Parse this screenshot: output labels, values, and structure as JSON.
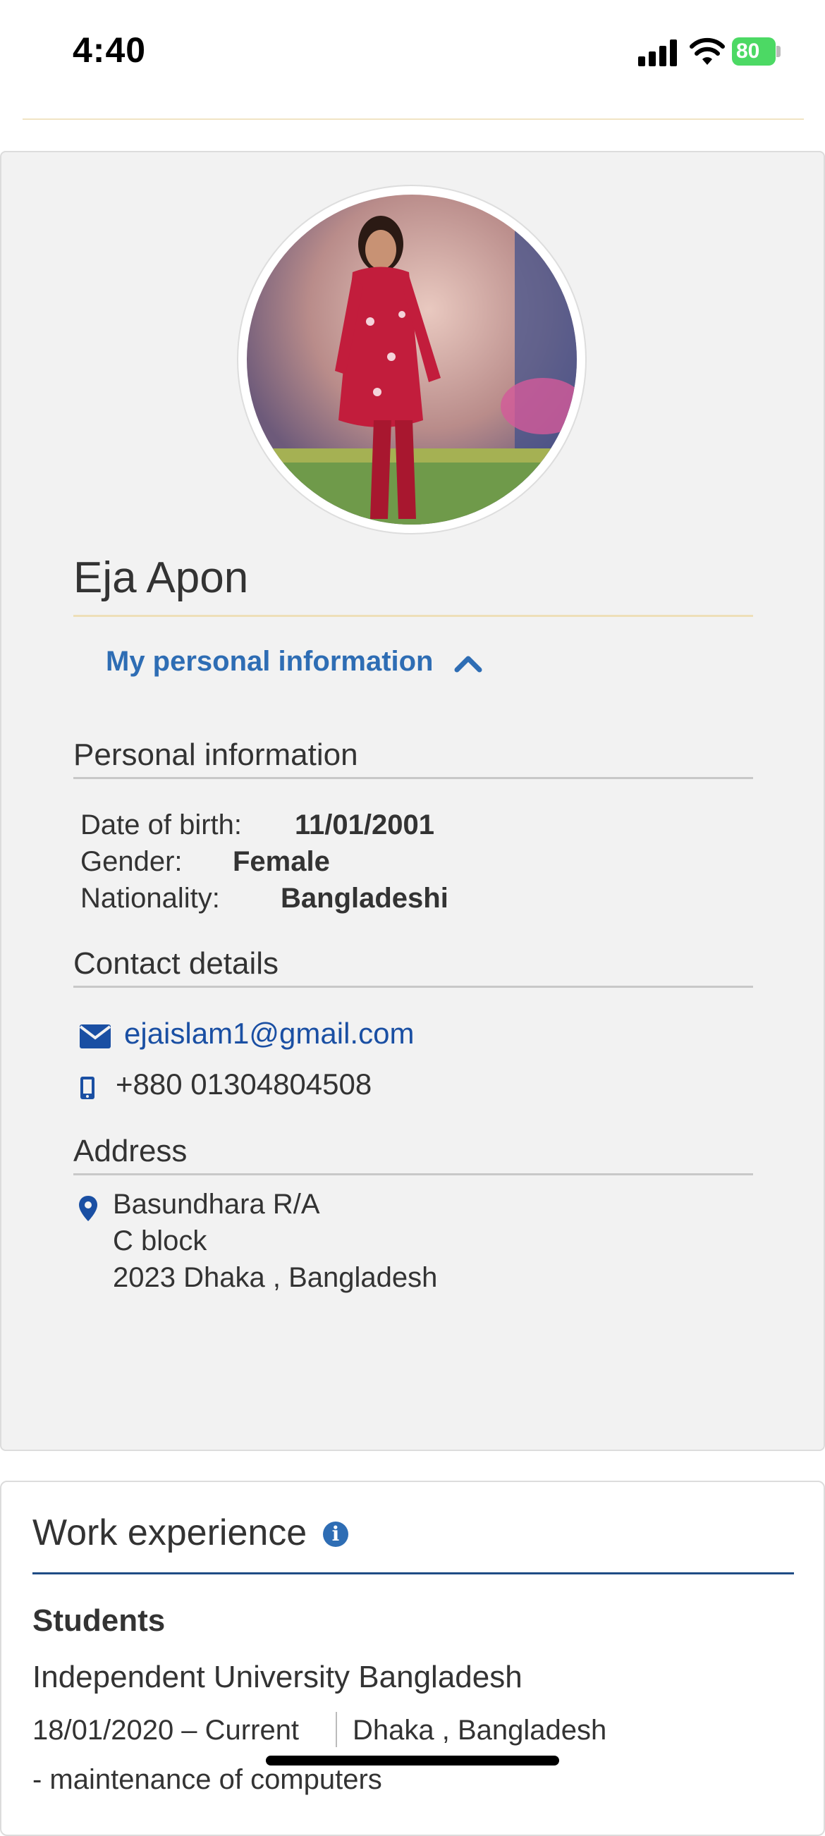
{
  "status_bar": {
    "time": "4:40",
    "battery": "80"
  },
  "profile": {
    "name": "Eja Apon",
    "toggle_label": "My personal information",
    "personal": {
      "title": "Personal information",
      "dob_label": "Date of birth:",
      "dob_value": "11/01/2001",
      "gender_label": "Gender:",
      "gender_value": "Female",
      "nationality_label": "Nationality:",
      "nationality_value": "Bangladeshi"
    },
    "contact": {
      "title": "Contact details",
      "email": "ejaislam1@gmail.com",
      "phone": "+880 01304804508"
    },
    "address": {
      "title": "Address",
      "line1": "Basundhara R/A",
      "line2": "C block",
      "line3": "2023 Dhaka , Bangladesh"
    }
  },
  "work": {
    "title": "Work experience",
    "job_title": "Students",
    "employer": "Independent University Bangladesh",
    "dates": "18/01/2020 – Current",
    "location": "Dhaka , Bangladesh",
    "description": "- maintenance of computers"
  },
  "colors": {
    "link": "#2e6db4",
    "email": "#1a4fa3",
    "battery": "#4cd964",
    "work_rule": "#1f4c85"
  }
}
